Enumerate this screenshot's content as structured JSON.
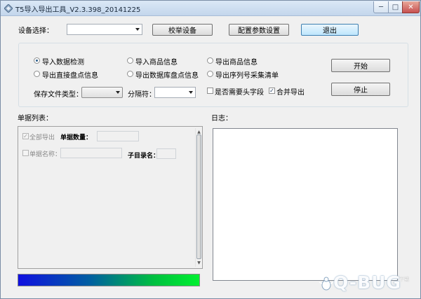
{
  "window": {
    "title": "T5导入导出工具_V2.3.398_20141225",
    "minimize_glyph": "─",
    "maximize_glyph": "□",
    "close_glyph": "✕"
  },
  "toolbar": {
    "device_label": "设备选择：",
    "device_selected": "",
    "calibrate_label": "校举设备",
    "config_label": "配置参数设置",
    "exit_label": "退出"
  },
  "options": {
    "radios": [
      {
        "label": "导入数据检测",
        "checked": true
      },
      {
        "label": "导入商品信息",
        "checked": false
      },
      {
        "label": "导出商品信息",
        "checked": false
      },
      {
        "label": "导出直接盘点信息",
        "checked": false
      },
      {
        "label": "导出数据库盘点信息",
        "checked": false
      },
      {
        "label": "导出序列号采集清单",
        "checked": false
      }
    ],
    "file_type_label": "保存文件类型：",
    "file_type_value": "",
    "separator_label": "分隔符：",
    "separator_value": "",
    "header_checkbox": {
      "label": "是否需要头字段",
      "checked": false
    },
    "merge_checkbox": {
      "label": "合并导出",
      "checked": true
    },
    "start_label": "开始",
    "stop_label": "停止"
  },
  "doc_list": {
    "title": "单据列表：",
    "export_all": {
      "label": "全部导出",
      "checked": true
    },
    "doc_count_label": "单据数量：",
    "doc_count_value": "",
    "doc_name": {
      "label": "单据名称：",
      "checked": false
    },
    "doc_name_value": "",
    "subdir_label": "子目录名：",
    "subdir_value": ""
  },
  "log": {
    "title": "日志："
  },
  "progress": {
    "value": 100
  },
  "watermark": {
    "text": "Q-BUG",
    "sub": "下载"
  },
  "icons": {
    "app": "app-icon",
    "check": "✓"
  },
  "colors": {
    "window_bg": "#f0f0f0",
    "progress_start": "#1010e0",
    "progress_end": "#00f030",
    "close_button": "#c75050"
  }
}
